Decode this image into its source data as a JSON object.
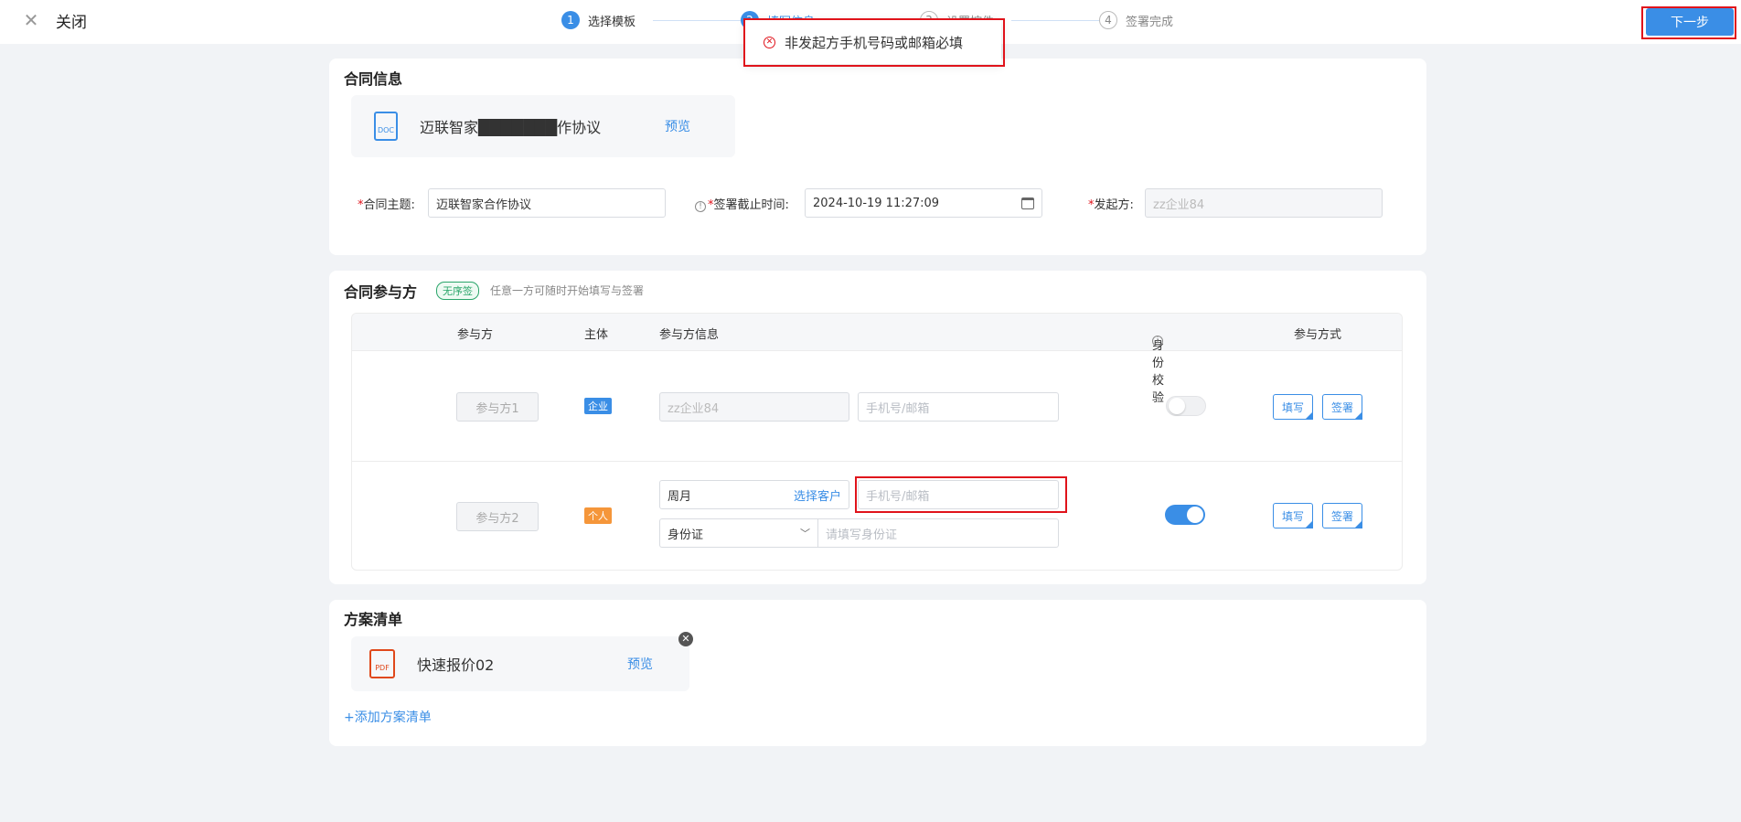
{
  "header": {
    "close_label": "关闭",
    "next_label": "下一步",
    "steps": [
      {
        "num": "1",
        "label": "选择模板"
      },
      {
        "num": "2",
        "label": "填写信息"
      },
      {
        "num": "3",
        "label": "设置控件"
      },
      {
        "num": "4",
        "label": "签署完成"
      }
    ]
  },
  "toast": {
    "message": "非发起方手机号码或邮箱必填"
  },
  "contract_info": {
    "title": "合同信息",
    "file_name": "迈联智家███████作协议",
    "preview_label": "预览",
    "subject_label": "合同主题:",
    "subject_value": "迈联智家合作协议",
    "deadline_label": "签署截止时间:",
    "deadline_value": "2024-10-19 11:27:09",
    "initiator_label": "发起方:",
    "initiator_value": "zz企业84"
  },
  "participants": {
    "title": "合同参与方",
    "order_tag": "无序签",
    "hint": "任意一方可随时开始填写与签署",
    "columns": [
      "参与方",
      "主体",
      "参与方信息",
      "身份校验",
      "参与方式"
    ],
    "rows": [
      {
        "party": "参与方1",
        "subject_type": "企业",
        "info_name": "zz企业84",
        "contact_placeholder": "手机号/邮箱",
        "verify_on": false,
        "fill_label": "填写",
        "sign_label": "签署"
      },
      {
        "party": "参与方2",
        "subject_type": "个人",
        "info_name": "周月",
        "select_customer_label": "选择客户",
        "contact_placeholder": "手机号/邮箱",
        "id_type": "身份证",
        "id_placeholder": "请填写身份证",
        "verify_on": true,
        "fill_label": "填写",
        "sign_label": "签署"
      }
    ]
  },
  "plan_list": {
    "title": "方案清单",
    "file_name": "快速报价02",
    "preview_label": "预览",
    "add_label": "+添加方案清单"
  },
  "colors": {
    "primary": "#3a8ee6",
    "error": "#e0131b",
    "enterprise_badge": "#3a8ee6",
    "personal_badge": "#f5963a",
    "tag_green": "#2aa56a"
  }
}
